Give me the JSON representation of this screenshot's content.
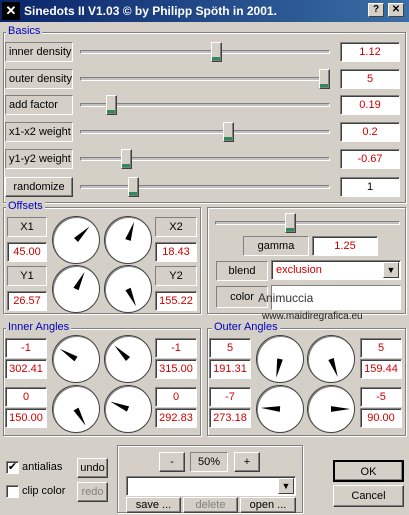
{
  "window": {
    "title": "Sinedots II V1.03 © by Philipp Spöth in 2001.",
    "logo_glyph": "✕",
    "help_glyph": "?",
    "close_glyph": "✕"
  },
  "basics": {
    "group_label": "Basics",
    "sliders": [
      {
        "label": "inner density",
        "value": "1.12",
        "position": 0.55,
        "color": "red"
      },
      {
        "label": "outer density",
        "value": "5",
        "position": 1.0,
        "color": "red"
      },
      {
        "label": "add factor",
        "value": "0.19",
        "position": 0.11,
        "color": "red"
      },
      {
        "label": "x1-x2 weight",
        "value": "0.2",
        "position": 0.6,
        "color": "red"
      },
      {
        "label": "y1-y2 weight",
        "value": "-0.67",
        "position": 0.17,
        "color": "red"
      },
      {
        "label": "randomize",
        "value": "1",
        "position": 0.2,
        "color": "black"
      }
    ]
  },
  "offsets": {
    "group_label": "Offsets",
    "x1_label": "X1",
    "x1_value": "45.00",
    "x2_label": "X2",
    "x2_value": "18.43",
    "y1_label": "Y1",
    "y1_value": "26.57",
    "y2_label": "Y2",
    "y2_value": "155.22",
    "dial_angles": [
      45.0,
      18.43,
      26.57,
      155.22
    ]
  },
  "blend_panel": {
    "gamma_label": "gamma",
    "gamma_value": "1.25",
    "gamma_position": 0.4,
    "blend_label": "blend",
    "blend_value": "exclusion",
    "color_label": "color",
    "watermark": "Animuccia",
    "watermark_url": "www.maidiregrafica.eu"
  },
  "inner_angles": {
    "group_label": "Inner Angles",
    "left_top": "-1",
    "left_top_value": "302.41",
    "right_top": "-1",
    "right_top_value": "315.00",
    "left_bottom": "0",
    "left_bottom_value": "150.00",
    "right_bottom": "0",
    "right_bottom_value": "292.83",
    "dial_angles": [
      302.41,
      315.0,
      150.0,
      292.83
    ]
  },
  "outer_angles": {
    "group_label": "Outer Angles",
    "left_top": "5",
    "left_top_value": "191.31",
    "right_top": "5",
    "right_top_value": "159.44",
    "left_bottom": "-7",
    "left_bottom_value": "273.18",
    "right_bottom": "-5",
    "right_bottom_value": "90.00",
    "dial_angles": [
      191.31,
      159.44,
      273.18,
      90.0
    ]
  },
  "footer": {
    "antialias_label": "antialias",
    "antialias_checked": true,
    "clipcolor_label": "clip color",
    "clipcolor_checked": false,
    "undo_label": "undo",
    "redo_label": "redo",
    "zoom_minus": "-",
    "zoom_value": "50%",
    "zoom_plus": "+",
    "save_label": "save ...",
    "delete_label": "delete",
    "open_label": "open ...",
    "ok_label": "OK",
    "cancel_label": "Cancel"
  }
}
